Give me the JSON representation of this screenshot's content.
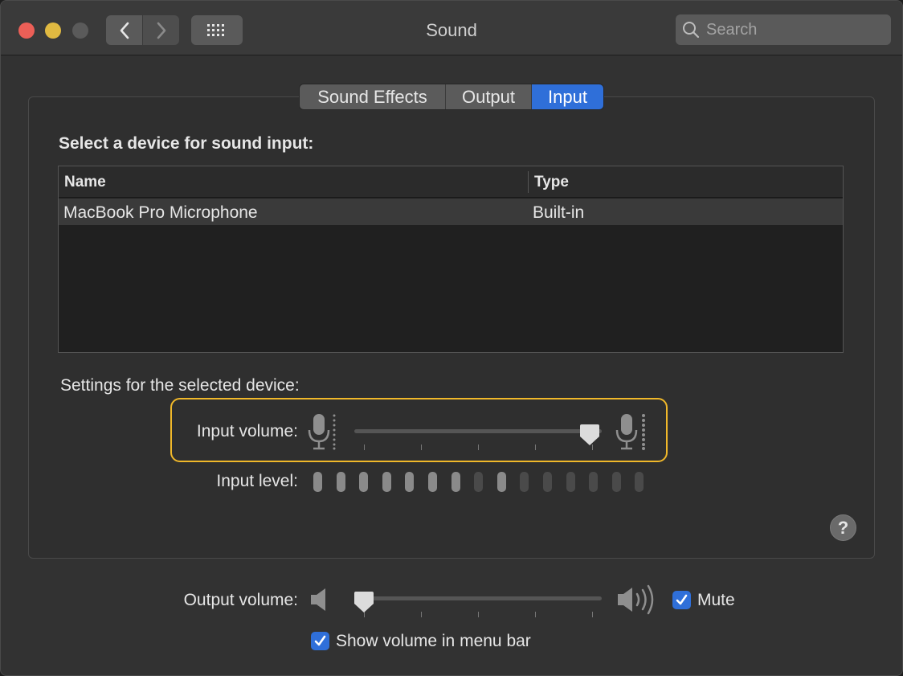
{
  "window": {
    "title": "Sound",
    "search": {
      "placeholder": "Search"
    }
  },
  "tabs": [
    {
      "label": "Sound Effects",
      "selected": false
    },
    {
      "label": "Output",
      "selected": false
    },
    {
      "label": "Input",
      "selected": true
    }
  ],
  "device_section": {
    "heading": "Select a device for sound input:",
    "columns": [
      "Name",
      "Type"
    ],
    "rows": [
      {
        "name": "MacBook Pro Microphone",
        "type": "Built-in",
        "selected": true
      }
    ]
  },
  "settings": {
    "heading": "Settings for the selected device:",
    "input_volume_label": "Input volume:",
    "input_volume_fraction": 0.95,
    "input_level_label": "Input level:",
    "input_level_bars": 15,
    "input_level_lit": [
      1,
      1,
      1,
      1,
      1,
      1,
      1,
      0,
      1,
      0,
      0,
      0,
      0,
      0,
      0
    ],
    "help_label": "?"
  },
  "output": {
    "volume_label": "Output volume:",
    "volume_fraction": 0.04,
    "mute_label": "Mute",
    "mute_checked": true,
    "show_in_menu_bar_label": "Show volume in menu bar",
    "show_in_menu_bar_checked": true
  },
  "colors": {
    "accent": "#2f6fd9",
    "highlight": "#f0b82a",
    "level_on": "#8a8a8a",
    "level_off": "#4a4a4a"
  }
}
